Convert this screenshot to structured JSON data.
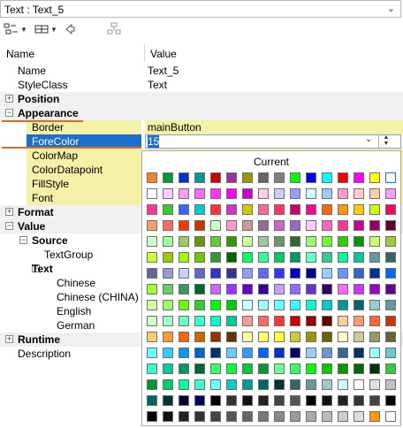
{
  "object_selector": {
    "title": "Text : Text_5"
  },
  "header": {
    "name": "Name",
    "value": "Value"
  },
  "rows": [
    {
      "name": "Name",
      "value": "Text_5",
      "indent": 0,
      "kind": "prop"
    },
    {
      "name": "StyleClass",
      "value": "Text",
      "indent": 0,
      "kind": "prop"
    },
    {
      "name": "Position",
      "value": "",
      "indent": 0,
      "kind": "cat",
      "expander": "+"
    },
    {
      "name": "Appearance",
      "value": "",
      "indent": 0,
      "kind": "cat",
      "expander": "−"
    },
    {
      "name": "Border",
      "value": "mainButton",
      "indent": 2,
      "kind": "yel"
    },
    {
      "name": "ForeColor",
      "value": "",
      "indent": 2,
      "kind": "selected"
    },
    {
      "name": "ColorMap",
      "value": "",
      "indent": 2,
      "kind": "yel"
    },
    {
      "name": "ColorDatapoint",
      "value": "",
      "indent": 2,
      "kind": "yel"
    },
    {
      "name": "FillStyle",
      "value": "",
      "indent": 2,
      "kind": "yel"
    },
    {
      "name": "Font",
      "value": "",
      "indent": 2,
      "kind": "yel"
    },
    {
      "name": "Format",
      "value": "",
      "indent": 0,
      "kind": "cat",
      "expander": "+"
    },
    {
      "name": "Value",
      "value": "",
      "indent": 0,
      "kind": "cat",
      "expander": "−"
    },
    {
      "name": "Source",
      "value": "",
      "indent": 1,
      "kind": "subcat",
      "expander": "−"
    },
    {
      "name": "TextGroup",
      "value": "",
      "indent": 3,
      "kind": "prop"
    },
    {
      "name": "Text",
      "value": "",
      "indent": 2,
      "kind": "subcat",
      "expander": "−"
    },
    {
      "name": "Chinese",
      "value": "",
      "indent": 4,
      "kind": "prop"
    },
    {
      "name": "Chinese (CHINA)",
      "value": "",
      "indent": 4,
      "kind": "prop"
    },
    {
      "name": "English",
      "value": "",
      "indent": 4,
      "kind": "prop"
    },
    {
      "name": "German",
      "value": "",
      "indent": 4,
      "kind": "prop"
    },
    {
      "name": "Runtime",
      "value": "",
      "indent": 0,
      "kind": "cat",
      "expander": "+"
    },
    {
      "name": "Description",
      "value": "",
      "indent": 0,
      "kind": "prop"
    }
  ],
  "editor": {
    "value": "15"
  },
  "palette": {
    "title": "Current",
    "colors": [
      [
        "#f58220",
        "#009b3a",
        "#0033cc",
        "#009999",
        "#cc0000",
        "#993399",
        "#999900",
        "#666666",
        "#808080",
        "#00ff00",
        "#0000ff",
        "#00ffff",
        "#ff0000",
        "#ff00ff",
        "#ffff00",
        "#ffffff"
      ],
      [
        "#ffffff",
        "#ffccff",
        "#ff99ff",
        "#ff66ff",
        "#ff33ff",
        "#ff00ff",
        "#cc00cc",
        "#ffccee",
        "#ccccff",
        "#9999ff",
        "#ccffff",
        "#99ccff",
        "#ff99cc",
        "#ffcccc",
        "#ffccaa",
        "#ff99ff"
      ],
      [
        "#ff3399",
        "#33cc33",
        "#3366ff",
        "#00cccc",
        "#ff3333",
        "#cc33cc",
        "#cccc00",
        "#ff6699",
        "#ff3366",
        "#cc0066",
        "#ff0099",
        "#ff6600",
        "#ff9900",
        "#ffcc00",
        "#ccff00",
        "#ff0066"
      ],
      [
        "#ff9966",
        "#ff6666",
        "#ff3300",
        "#cc3300",
        "#ccffcc",
        "#ff99cc",
        "#cc9999",
        "#996699",
        "#cc66cc",
        "#9966cc",
        "#ffccff",
        "#ff66cc",
        "#ff3399",
        "#cc0099",
        "#990066",
        "#660033"
      ],
      [
        "#ccffcc",
        "#99ff99",
        "#99cc66",
        "#669900",
        "#66cc33",
        "#339900",
        "#ccff99",
        "#99cc99",
        "#669966",
        "#336633",
        "#99ff66",
        "#66ff33",
        "#33cc00",
        "#009900",
        "#ccff66",
        "#99cc33"
      ],
      [
        "#ccff33",
        "#99cc00",
        "#99ff00",
        "#66cc00",
        "#339933",
        "#006600",
        "#00ff66",
        "#33ff99",
        "#00cc66",
        "#009966",
        "#66ffcc",
        "#33cc99",
        "#00ff99",
        "#00cc99",
        "#669999",
        "#336666"
      ],
      [
        "#666699",
        "#9999cc",
        "#ccccff",
        "#6666cc",
        "#3333cc",
        "#333399",
        "#9999ff",
        "#6666ff",
        "#3333ff",
        "#0000cc",
        "#000099",
        "#99ccff",
        "#6699ff",
        "#3366cc",
        "#003399",
        "#0066ff"
      ],
      [
        "#99ff33",
        "#66cc66",
        "#339966",
        "#006633",
        "#cc66ff",
        "#9933ff",
        "#6600cc",
        "#330099",
        "#cc99ff",
        "#9966ff",
        "#6633cc",
        "#330066",
        "#ff66ff",
        "#cc33ff",
        "#9900cc",
        "#660099"
      ],
      [
        "#ccff99",
        "#99ff66",
        "#66ff00",
        "#33cc33",
        "#00ff00",
        "#00cc00",
        "#ccffff",
        "#99ffff",
        "#66ffff",
        "#33ffff",
        "#00ffcc",
        "#00cccc",
        "#009999",
        "#006666",
        "#99cccc",
        "#669999"
      ],
      [
        "#ccffcc",
        "#99ffcc",
        "#66ffcc",
        "#33ffcc",
        "#00ffcc",
        "#00cc99",
        "#ff9999",
        "#ff6666",
        "#ff3333",
        "#cc0000",
        "#990000",
        "#660000",
        "#ffcc99",
        "#ff9966",
        "#ff6633",
        "#cc3300"
      ],
      [
        "#ffcc66",
        "#ff9933",
        "#ff6600",
        "#cc6600",
        "#993300",
        "#663300",
        "#ffff99",
        "#ffff66",
        "#ffff33",
        "#cccc33",
        "#999900",
        "#666600",
        "#ffffcc",
        "#cccc99",
        "#999966",
        "#666633"
      ],
      [
        "#66ffff",
        "#33ccff",
        "#0099ff",
        "#0066cc",
        "#003366",
        "#66ccff",
        "#3399ff",
        "#0066ff",
        "#0033cc",
        "#000066",
        "#99ccff",
        "#6699cc",
        "#336699",
        "#003366",
        "#99ffff",
        "#66cccc"
      ],
      [
        "#33ffcc",
        "#00cc99",
        "#009966",
        "#006633",
        "#33ff66",
        "#00ff33",
        "#00cc33",
        "#009933",
        "#66ff99",
        "#33ff66",
        "#00ff00",
        "#00cc00",
        "#009900",
        "#006600",
        "#003300",
        "#33cc33"
      ],
      [
        "#009933",
        "#00cc66",
        "#00ff99",
        "#33ffcc",
        "#66ffff",
        "#00cccc",
        "#009999",
        "#006666",
        "#003333",
        "#336666",
        "#669999",
        "#99cccc",
        "#ccffff",
        "#ffffff",
        "#e0e0e0",
        "#c0c0c0"
      ],
      [
        "#006666",
        "#003333",
        "#000033",
        "#000066",
        "#000000",
        "#333333",
        "#111111",
        "#222222",
        "#444444",
        "#555555",
        "#000000",
        "#111111",
        "#222222",
        "#333333",
        "#444444",
        "#000000"
      ],
      [
        "#000000",
        "#111111",
        "#222222",
        "#333333",
        "#444444",
        "#555555",
        "#666666",
        "#777777",
        "#888888",
        "#999999",
        "#aaaaaa",
        "#bbbbbb",
        "#cccccc",
        "#dddddd",
        "#ff9900",
        "#ffffff"
      ]
    ]
  },
  "colors": {
    "selected_bg": "#1b6fcf",
    "accent": "#e06a1e",
    "highlight_bg": "#f4f0a8",
    "category_bg": "#f0f0f0"
  }
}
